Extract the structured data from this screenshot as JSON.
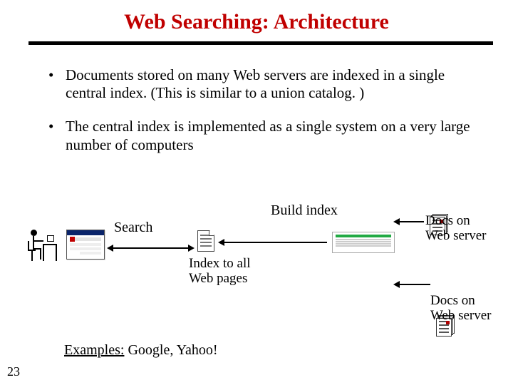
{
  "title": "Web Searching: Architecture",
  "bullets": [
    "Documents stored on many Web servers are indexed in a single central index.  (This is similar to a union catalog. )",
    "The central index is implemented as a single system on a very large number of computers"
  ],
  "labels": {
    "search": "Search",
    "build_index": "Build index",
    "index_caption": "Index to all Web pages",
    "docs_caption": "Docs on Web server"
  },
  "examples": {
    "prefix": "Examples:",
    "list": "  Google, Yahoo!"
  },
  "slide_number": "23"
}
